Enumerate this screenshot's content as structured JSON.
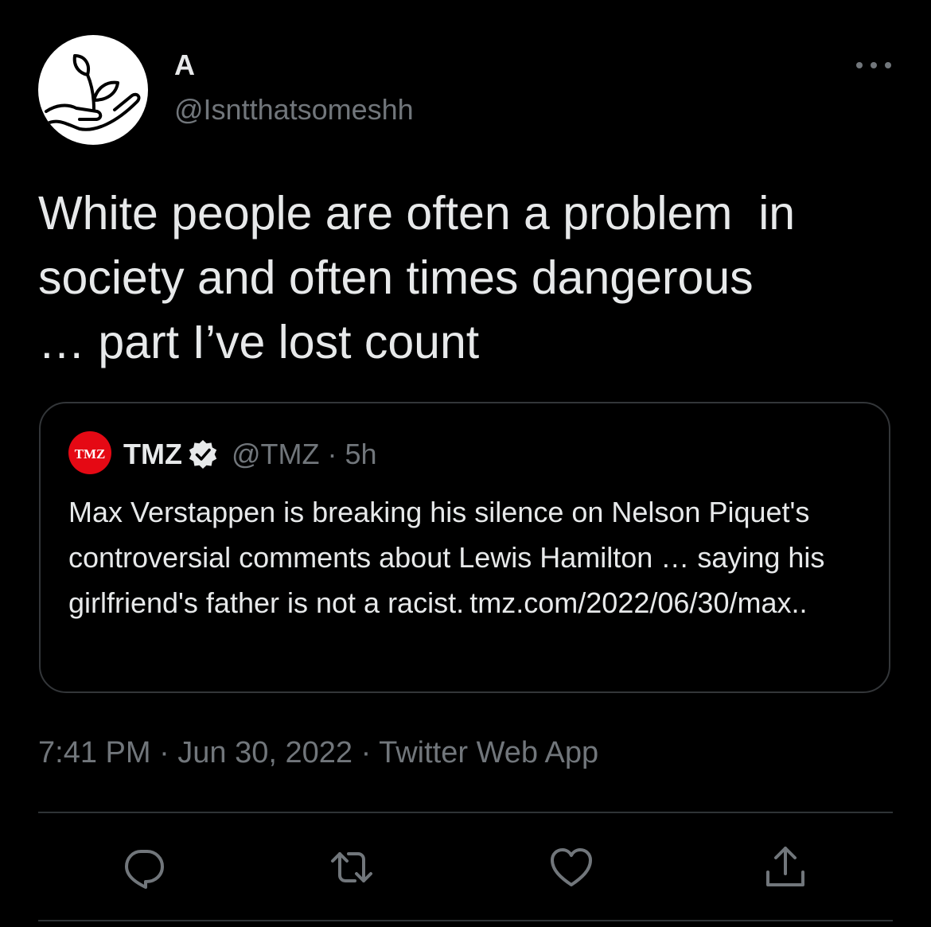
{
  "author": {
    "display_name": "A",
    "handle": "@Isntthatsomeshh",
    "avatar_icon": "plant-in-hand-icon"
  },
  "tweet": {
    "text": "White people are often a problem  in\nsociety and often times dangerous\n… part I’ve lost count"
  },
  "quoted_tweet": {
    "avatar_text": "TMZ",
    "name": "TMZ",
    "verified": true,
    "handle_time": "@TMZ · 5h",
    "text": "Max Verstappen is breaking his silence on Nelson Piquet's controversial comments about Lewis Hamilton … saying his girlfriend's father is not a racist. tmz.com/2022/06/30/max.."
  },
  "meta": {
    "timestamp_line": "7:41 PM · Jun 30, 2022 · Twitter Web App"
  },
  "actions": {
    "reply_icon": "reply-icon",
    "retweet_icon": "retweet-icon",
    "like_icon": "heart-icon",
    "share_icon": "share-icon"
  },
  "colors": {
    "background": "#000000",
    "text_primary": "#e7e9ea",
    "text_secondary": "#71767b",
    "border": "#333639",
    "tmz_red": "#e50914"
  }
}
